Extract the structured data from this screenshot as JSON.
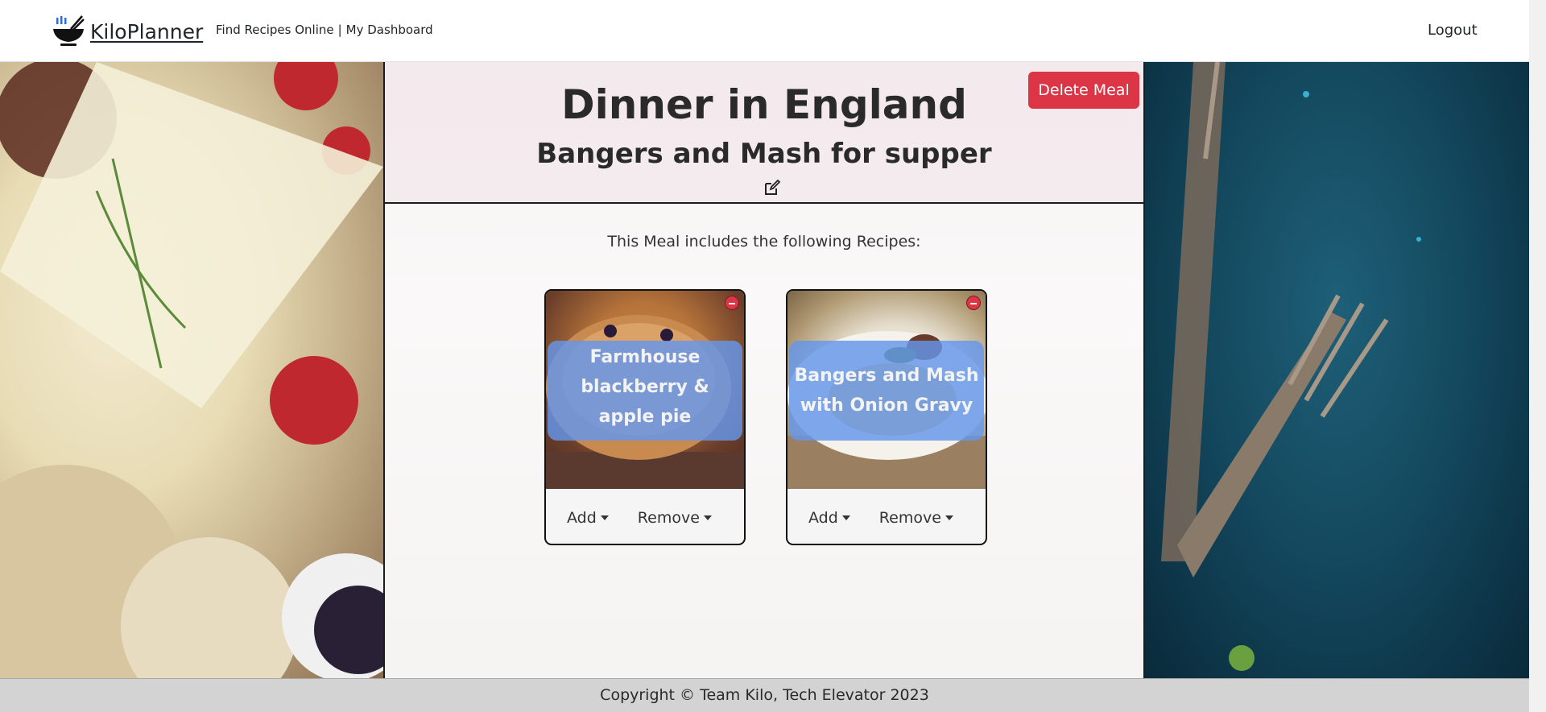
{
  "brand": {
    "name": "KiloPlanner",
    "logo_icon": "bowl-chopsticks-icon"
  },
  "nav": {
    "links": [
      "Find Recipes Online",
      "My Dashboard"
    ],
    "separator": "|",
    "logout": "Logout"
  },
  "meal": {
    "title": "Dinner in England",
    "subtitle": "Bangers and Mash for supper",
    "delete_label": "Delete Meal",
    "includes_text": "This Meal includes the following Recipes:"
  },
  "recipes": [
    {
      "title": "Farmhouse blackberry & apple pie",
      "add_label": "Add",
      "remove_label": "Remove"
    },
    {
      "title": "Bangers and Mash with Onion Gravy",
      "add_label": "Add",
      "remove_label": "Remove"
    }
  ],
  "footer": {
    "text": "Copyright © Team Kilo, Tech Elevator 2023"
  },
  "colors": {
    "danger": "#dc3545",
    "card_label": "#6496eb",
    "footer_bg": "#d3d3d3"
  }
}
